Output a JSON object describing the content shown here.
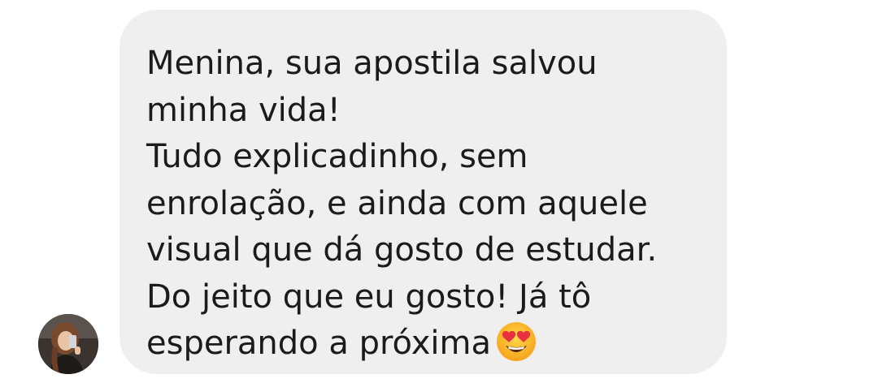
{
  "message": {
    "lines": [
      "Menina, sua apostila salvou",
      "minha vida!",
      "Tudo explicadinho, sem",
      "enrolação, e ainda com aquele",
      "visual que dá gosto de estudar.",
      "Do jeito que eu gosto! Já tô",
      "esperando a próxima"
    ],
    "emoji": "smiling-face-with-heart-eyes"
  },
  "avatar": {
    "icon": "profile-photo"
  },
  "colors": {
    "bubble": "#efefef",
    "text": "#1b1b1b",
    "background": "#ffffff"
  }
}
